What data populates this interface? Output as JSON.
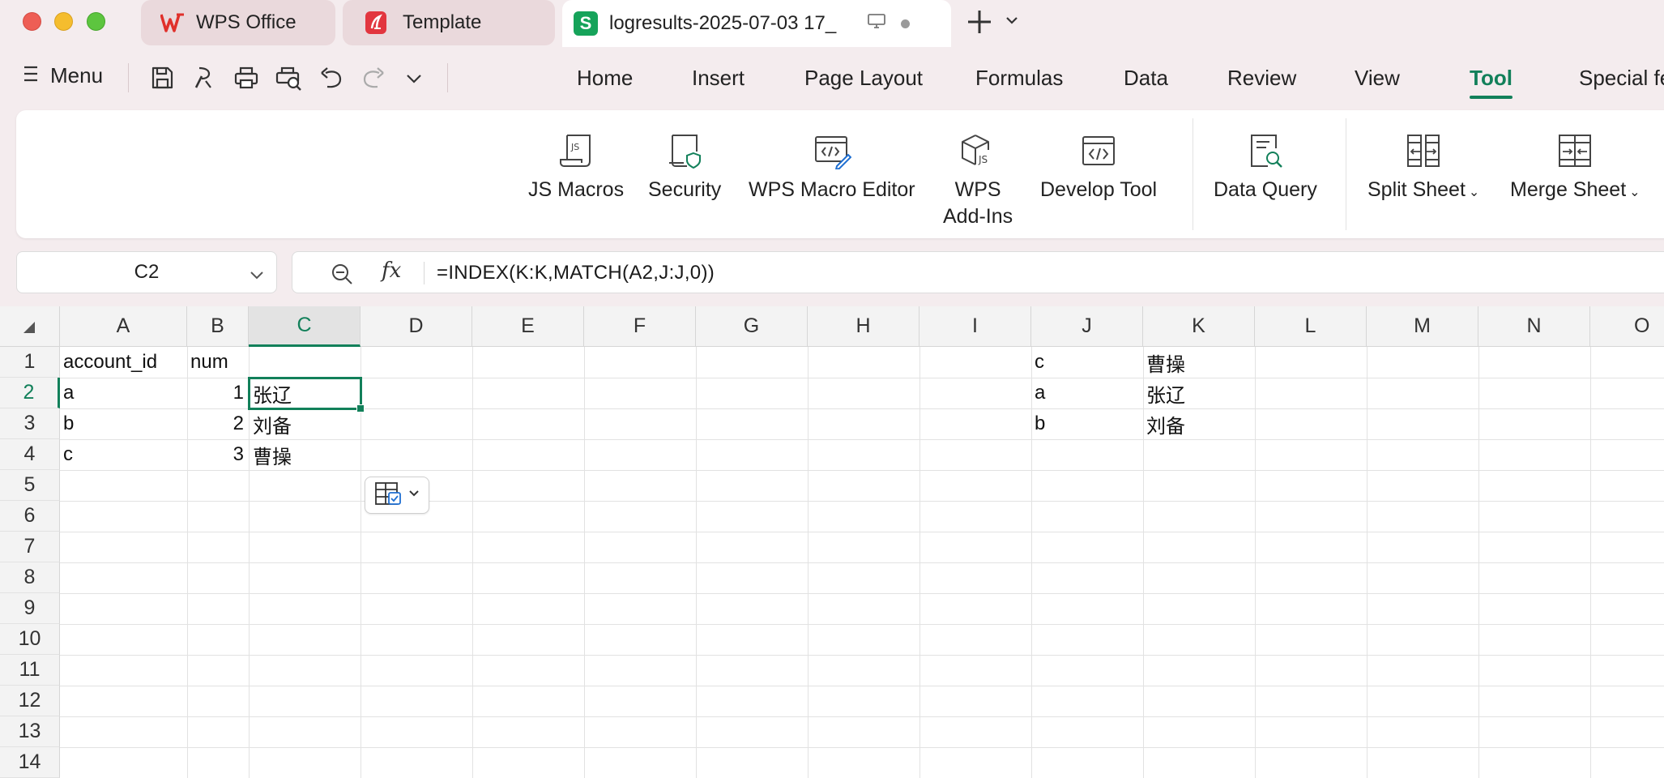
{
  "tabs": [
    {
      "label": "WPS Office"
    },
    {
      "label": "Template"
    },
    {
      "label": "logresults-2025-07-03 17_"
    }
  ],
  "menu": {
    "label": "Menu",
    "ribbon_tabs": [
      "Home",
      "Insert",
      "Page Layout",
      "Formulas",
      "Data",
      "Review",
      "View",
      "Tool",
      "Special fe"
    ],
    "active_tab": "Tool"
  },
  "ribbon": {
    "js_macros": "JS Macros",
    "security": "Security",
    "macro_editor": "WPS Macro Editor",
    "addins_line1": "WPS",
    "addins_line2": "Add-Ins",
    "develop_tool": "Develop Tool",
    "data_query": "Data Query",
    "split_sheet": "Split Sheet",
    "merge_sheet": "Merge Sheet"
  },
  "formula_bar": {
    "name_box": "C2",
    "fx": "fx",
    "formula": "=INDEX(K:K,MATCH(A2,J:J,0))"
  },
  "sheet": {
    "columns": [
      "A",
      "B",
      "C",
      "D",
      "E",
      "F",
      "G",
      "H",
      "I",
      "J",
      "K",
      "L",
      "M",
      "N",
      "O"
    ],
    "rows": [
      "1",
      "2",
      "3",
      "4",
      "5",
      "6",
      "7",
      "8",
      "9",
      "10",
      "11",
      "12",
      "13",
      "14"
    ],
    "selected_cell": "C2",
    "cells": {
      "A1": "account_id",
      "B1": "num",
      "A2": "a",
      "B2": "1",
      "C2": "张辽",
      "A3": "b",
      "B3": "2",
      "C3": "刘备",
      "A4": "c",
      "B4": "3",
      "C4": "曹操",
      "J1": "c",
      "K1": "曹操",
      "J2": "a",
      "K2": "张辽",
      "J3": "b",
      "K3": "刘备"
    }
  },
  "colors": {
    "accent": "#12805a",
    "sheet_icon": "#16a35a",
    "wps_red": "#e0302b"
  }
}
